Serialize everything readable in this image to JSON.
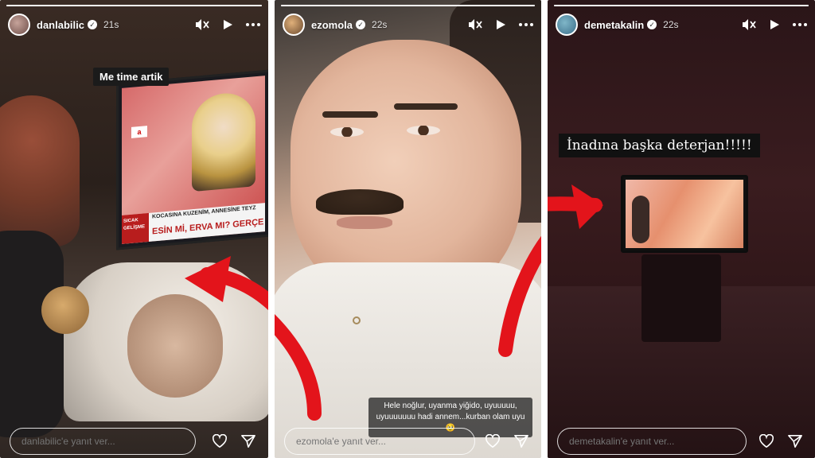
{
  "stories": [
    {
      "username": "danlabilic",
      "time": "21s",
      "caption": "Me time artik",
      "tv": {
        "channel_logo": "a",
        "band_red": "SICAK GELİŞME",
        "band_line1": "KOCASINA KUZENİM, ANNESİNE TEYZ",
        "band_line2": "ESİN Mİ, ERVA MI? GERÇE"
      },
      "reply_placeholder": "danlabilic'e yanıt ver...",
      "progress": 1.0
    },
    {
      "username": "ezomola",
      "time": "22s",
      "caption": "Hele noğlur, uyanma yiğido, uyuuuuu, uyuuuuuuu hadi annem...kurban olam uyu 🥹",
      "reply_placeholder": "ezomola'e yanıt ver...",
      "progress": 1.0
    },
    {
      "username": "demetakalin",
      "time": "22s",
      "caption": "İnadına başka deterjan!!!!!",
      "reply_placeholder": "demetakalin'e yanıt ver...",
      "progress": 1.0
    }
  ],
  "icons": {
    "mute": "speaker-muted-icon",
    "play": "play-icon",
    "more": "more-icon",
    "like": "heart-icon",
    "share": "send-icon"
  },
  "colors": {
    "arrow": "#e3141b",
    "caption_bg": "#1b1b1b"
  }
}
